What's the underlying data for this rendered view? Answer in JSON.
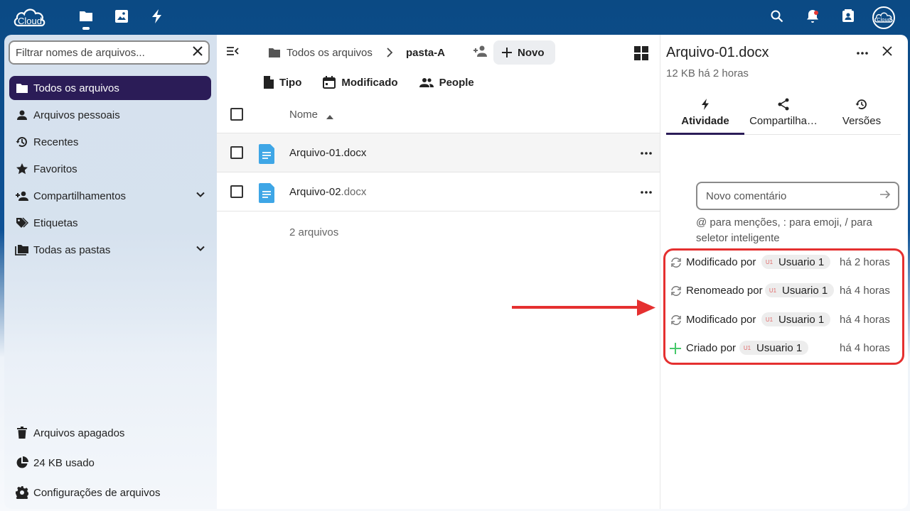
{
  "topbar": {
    "logo_text": "Cloud",
    "apps": [
      {
        "icon": "folder-icon",
        "active": true
      },
      {
        "icon": "image-icon",
        "active": false
      },
      {
        "icon": "lightning-icon",
        "active": false
      }
    ],
    "right_icons": [
      "search-icon",
      "bell-icon",
      "contacts-icon"
    ],
    "avatar_text": "Cloud"
  },
  "sidebar": {
    "filter_placeholder": "Filtrar nomes de arquivos...",
    "items": [
      {
        "label": "Todos os arquivos",
        "icon": "folder-icon",
        "active": true
      },
      {
        "label": "Arquivos pessoais",
        "icon": "person-icon",
        "active": false
      },
      {
        "label": "Recentes",
        "icon": "history-icon",
        "active": false
      },
      {
        "label": "Favoritos",
        "icon": "star-icon",
        "active": false
      },
      {
        "label": "Compartilhamentos",
        "icon": "share-person-icon",
        "active": false,
        "expandable": true
      },
      {
        "label": "Etiquetas",
        "icon": "tag-icon",
        "active": false
      },
      {
        "label": "Todas as pastas",
        "icon": "folders-icon",
        "active": false,
        "expandable": true
      }
    ],
    "bottom": [
      {
        "label": "Arquivos apagados",
        "icon": "trash-icon"
      },
      {
        "label": "24 KB usado",
        "icon": "pie-icon"
      },
      {
        "label": "Configurações de arquivos",
        "icon": "gear-icon"
      }
    ]
  },
  "main": {
    "breadcrumb": [
      "Todos os arquivos",
      "pasta-A"
    ],
    "new_label": "Novo",
    "filters": [
      {
        "label": "Tipo",
        "icon": "file-icon"
      },
      {
        "label": "Modificado",
        "icon": "calendar-icon"
      },
      {
        "label": "People",
        "icon": "people-icon"
      }
    ],
    "column_name": "Nome",
    "files": [
      {
        "base": "Arquivo-01",
        "ext": ".docx"
      },
      {
        "base": "Arquivo-02",
        "ext": ".docx"
      }
    ],
    "summary": "2 arquivos"
  },
  "details": {
    "title": "Arquivo-01.docx",
    "subtitle": "12 KB há 2 horas",
    "tabs": [
      {
        "label": "Atividade",
        "icon": "lightning-icon",
        "active": true
      },
      {
        "label": "Compartilha…",
        "icon": "share-icon",
        "active": false
      },
      {
        "label": "Versões",
        "icon": "restore-icon",
        "active": false
      }
    ],
    "comment_placeholder": "Novo comentário",
    "hint": "@ para menções, : para emoji, / para seletor inteligente",
    "activities": [
      {
        "text": "Modificado por",
        "user_initials": "U1",
        "user": "Usuario 1",
        "time": "há 2 horas",
        "icon": "sync-icon"
      },
      {
        "text": "Renomeado por",
        "user_initials": "U1",
        "user": "Usuario 1",
        "time": "há 4 horas",
        "icon": "sync-icon"
      },
      {
        "text": "Modificado por",
        "user_initials": "U1",
        "user": "Usuario 1",
        "time": "há 4 horas",
        "icon": "sync-icon"
      },
      {
        "text": "Criado por",
        "user_initials": "U1",
        "user": "Usuario 1",
        "time": "há 4 horas",
        "icon": "plus-icon"
      }
    ]
  },
  "colors": {
    "topbar": "#0b4a84",
    "active_nav": "#2b1c57",
    "highlight": "#e53030",
    "file_icon": "#3ea6e6",
    "created_icon": "#46c86a"
  }
}
